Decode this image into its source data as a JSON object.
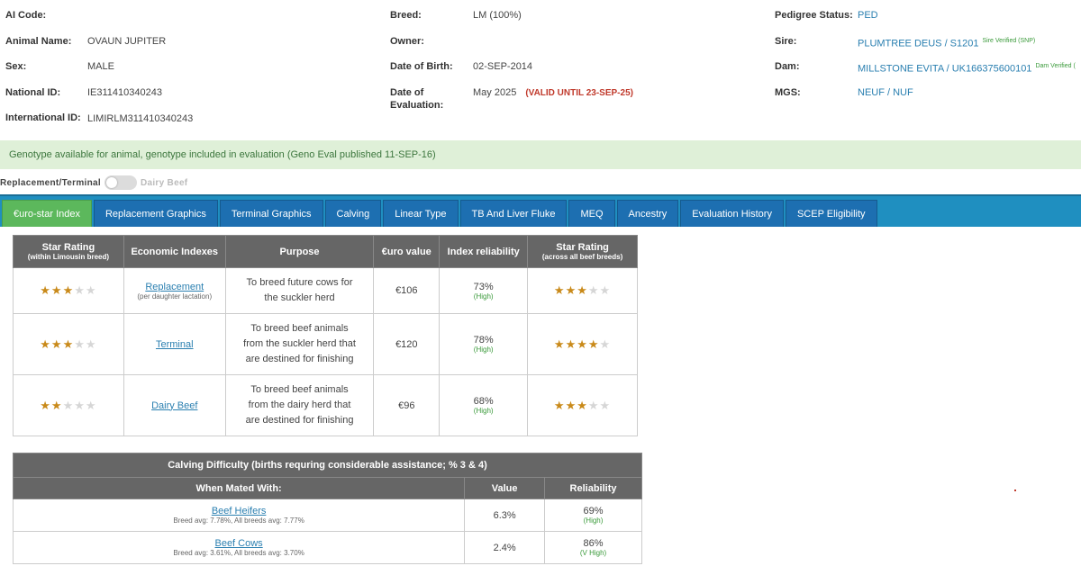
{
  "info": {
    "col1": {
      "ai_code_label": "AI Code:",
      "ai_code_value": "",
      "animal_name_label": "Animal Name:",
      "animal_name_value": "OVAUN JUPITER",
      "sex_label": "Sex:",
      "sex_value": "MALE",
      "national_id_label": "National ID:",
      "national_id_value": "IE311410340243",
      "international_id_label": "International ID:",
      "international_id_value": "LIMIRLM311410340243"
    },
    "col2": {
      "breed_label": "Breed:",
      "breed_value": "LM (100%)",
      "owner_label": "Owner:",
      "owner_value": "",
      "dob_label": "Date of Birth:",
      "dob_value": "02-SEP-2014",
      "eval_label_1": "Date of",
      "eval_label_2": "Evaluation:",
      "eval_value": "May 2025",
      "eval_valid": "(VALID UNTIL 23-SEP-25)"
    },
    "col3": {
      "pedigree_label": "Pedigree Status:",
      "pedigree_value": "PED",
      "sire_label": "Sire:",
      "sire_value": "PLUMTREE DEUS / S1201",
      "sire_badge": "Sire Verified (SNP)",
      "dam_label": "Dam:",
      "dam_value": "MILLSTONE EVITA / UK166375600101",
      "dam_badge": "Dam Verified (",
      "mgs_label": "MGS:",
      "mgs_value": "NEUF / NUF"
    }
  },
  "banner": "Genotype available for animal, genotype included in evaluation (Geno Eval published 11-SEP-16)",
  "toggle": {
    "left_label": "Replacement/Terminal",
    "right_label": "Dairy Beef"
  },
  "tabs": [
    "€uro-star Index",
    "Replacement Graphics",
    "Terminal Graphics",
    "Calving",
    "Linear Type",
    "TB And Liver Fluke",
    "MEQ",
    "Ancestry",
    "Evaluation History",
    "SCEP Eligibility"
  ],
  "star_table": {
    "headers": {
      "star_within": "Star Rating",
      "star_within_sub": "(within Limousin breed)",
      "economic": "Economic Indexes",
      "purpose": "Purpose",
      "euro": "€uro value",
      "reliability": "Index reliability",
      "star_across": "Star Rating",
      "star_across_sub": "(across all beef breeds)"
    },
    "rows": [
      {
        "stars_within": 3,
        "index": "Replacement",
        "index_sub": "(per daughter lactation)",
        "purpose_1": "To breed future cows for",
        "purpose_2": "the suckler herd",
        "purpose_3": "",
        "euro": "€106",
        "reliability": "73%",
        "reliability_level": "(High)",
        "stars_across": 3
      },
      {
        "stars_within": 3,
        "index": "Terminal",
        "index_sub": "",
        "purpose_1": "To breed beef animals",
        "purpose_2": "from the suckler herd that",
        "purpose_3": "are destined for finishing",
        "euro": "€120",
        "reliability": "78%",
        "reliability_level": "(High)",
        "stars_across": 4
      },
      {
        "stars_within": 2,
        "index": "Dairy Beef",
        "index_sub": "",
        "purpose_1": "To breed beef animals",
        "purpose_2": "from the dairy herd that",
        "purpose_3": "are destined for finishing",
        "euro": "€96",
        "reliability": "68%",
        "reliability_level": "(High)",
        "stars_across": 3
      }
    ]
  },
  "calving_table": {
    "caption": "Calving Difficulty (births requring considerable assistance; % 3 & 4)",
    "headers": {
      "mated": "When Mated With:",
      "value": "Value",
      "reliability": "Reliability"
    },
    "rows": [
      {
        "name": "Beef Heifers",
        "avg": "Breed avg: 7.78%, All breeds avg: 7.77%",
        "value": "6.3%",
        "reliability": "69%",
        "reliability_level": "(High)"
      },
      {
        "name": "Beef Cows",
        "avg": "Breed avg: 3.61%, All breeds avg: 3.70%",
        "value": "2.4%",
        "reliability": "86%",
        "reliability_level": "(V High)"
      }
    ]
  },
  "colors": {
    "tab_bar": "#1f8fc0",
    "tab": "#1d6fb1",
    "tab_active": "#5cb85c",
    "banner_bg": "#dff0d8",
    "star_on": "#c98a1a",
    "header_bg": "#666666",
    "link": "#2a7fb0"
  }
}
